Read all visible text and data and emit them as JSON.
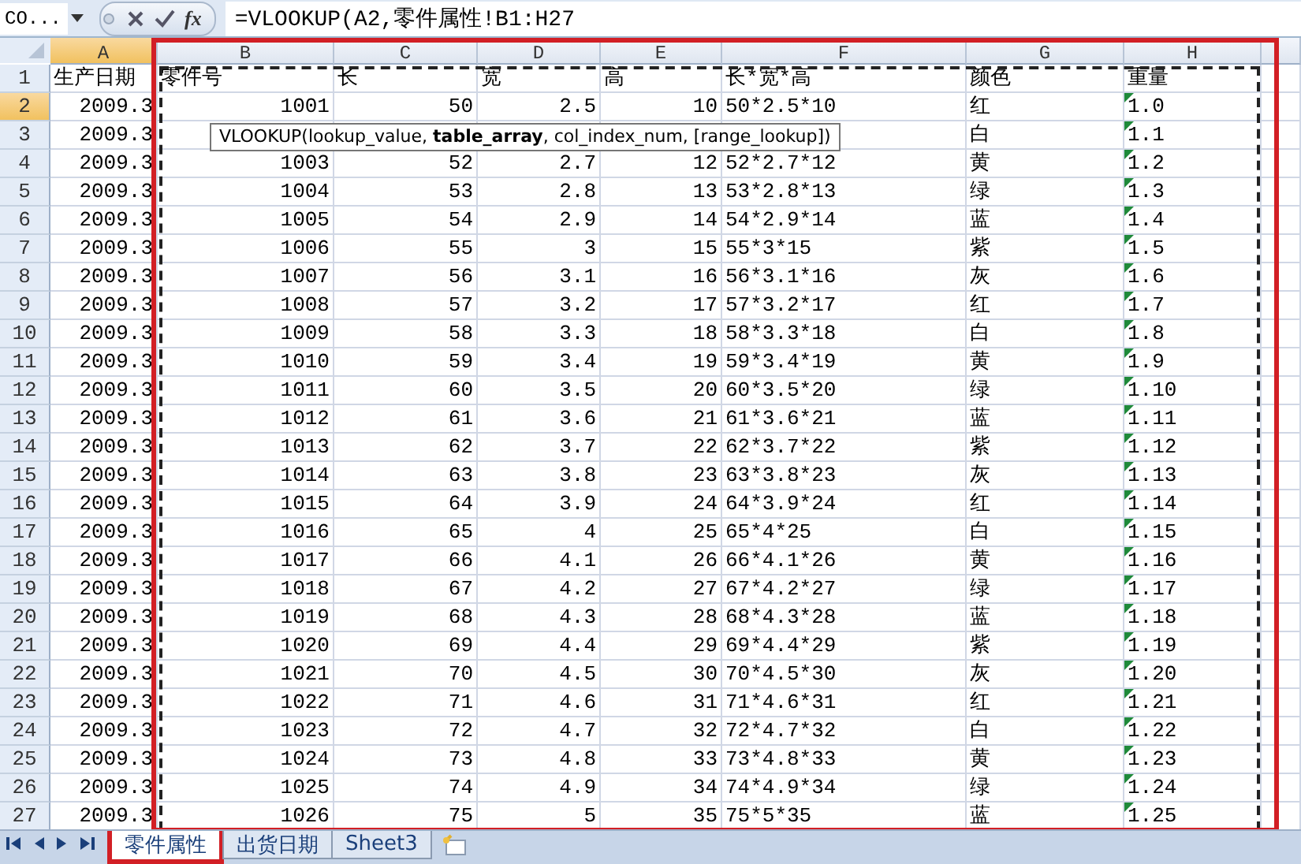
{
  "formula_bar": {
    "name_box": "CO...",
    "function_label": "fx",
    "formula": "=VLOOKUP(A2,零件属性!B1:H27"
  },
  "columns": [
    {
      "letter": "A",
      "kind": "number",
      "selected": true,
      "flagged": false
    },
    {
      "letter": "B",
      "kind": "number",
      "selected": false,
      "flagged": false
    },
    {
      "letter": "C",
      "kind": "number",
      "selected": false,
      "flagged": false
    },
    {
      "letter": "D",
      "kind": "number",
      "selected": false,
      "flagged": false
    },
    {
      "letter": "E",
      "kind": "number",
      "selected": false,
      "flagged": false
    },
    {
      "letter": "F",
      "kind": "text",
      "selected": false,
      "flagged": false
    },
    {
      "letter": "G",
      "kind": "text",
      "selected": false,
      "flagged": false
    },
    {
      "letter": "H",
      "kind": "text",
      "selected": false,
      "flagged": true
    }
  ],
  "rows": [
    {
      "number": "1",
      "kind": "header",
      "selected": false,
      "cells": [
        "生产日期",
        "零件号",
        "长",
        "宽",
        "高",
        "长*宽*高",
        "颜色",
        "重量"
      ]
    },
    {
      "number": "2",
      "kind": "data",
      "selected": true,
      "cells": [
        "2009.3",
        "1001",
        "50",
        "2.5",
        "10",
        "50*2.5*10",
        "红",
        "1.0"
      ]
    },
    {
      "number": "3",
      "kind": "data",
      "selected": false,
      "cells": [
        "2009.3",
        null,
        null,
        null,
        null,
        null,
        "白",
        "1.1"
      ]
    },
    {
      "number": "4",
      "kind": "data",
      "selected": false,
      "cells": [
        "2009.3",
        "1003",
        "52",
        "2.7",
        "12",
        "52*2.7*12",
        "黄",
        "1.2"
      ]
    },
    {
      "number": "5",
      "kind": "data",
      "selected": false,
      "cells": [
        "2009.3",
        "1004",
        "53",
        "2.8",
        "13",
        "53*2.8*13",
        "绿",
        "1.3"
      ]
    },
    {
      "number": "6",
      "kind": "data",
      "selected": false,
      "cells": [
        "2009.3",
        "1005",
        "54",
        "2.9",
        "14",
        "54*2.9*14",
        "蓝",
        "1.4"
      ]
    },
    {
      "number": "7",
      "kind": "data",
      "selected": false,
      "cells": [
        "2009.3",
        "1006",
        "55",
        "3",
        "15",
        "55*3*15",
        "紫",
        "1.5"
      ]
    },
    {
      "number": "8",
      "kind": "data",
      "selected": false,
      "cells": [
        "2009.3",
        "1007",
        "56",
        "3.1",
        "16",
        "56*3.1*16",
        "灰",
        "1.6"
      ]
    },
    {
      "number": "9",
      "kind": "data",
      "selected": false,
      "cells": [
        "2009.3",
        "1008",
        "57",
        "3.2",
        "17",
        "57*3.2*17",
        "红",
        "1.7"
      ]
    },
    {
      "number": "10",
      "kind": "data",
      "selected": false,
      "cells": [
        "2009.3",
        "1009",
        "58",
        "3.3",
        "18",
        "58*3.3*18",
        "白",
        "1.8"
      ]
    },
    {
      "number": "11",
      "kind": "data",
      "selected": false,
      "cells": [
        "2009.3",
        "1010",
        "59",
        "3.4",
        "19",
        "59*3.4*19",
        "黄",
        "1.9"
      ]
    },
    {
      "number": "12",
      "kind": "data",
      "selected": false,
      "cells": [
        "2009.3",
        "1011",
        "60",
        "3.5",
        "20",
        "60*3.5*20",
        "绿",
        "1.10"
      ]
    },
    {
      "number": "13",
      "kind": "data",
      "selected": false,
      "cells": [
        "2009.3",
        "1012",
        "61",
        "3.6",
        "21",
        "61*3.6*21",
        "蓝",
        "1.11"
      ]
    },
    {
      "number": "14",
      "kind": "data",
      "selected": false,
      "cells": [
        "2009.3",
        "1013",
        "62",
        "3.7",
        "22",
        "62*3.7*22",
        "紫",
        "1.12"
      ]
    },
    {
      "number": "15",
      "kind": "data",
      "selected": false,
      "cells": [
        "2009.3",
        "1014",
        "63",
        "3.8",
        "23",
        "63*3.8*23",
        "灰",
        "1.13"
      ]
    },
    {
      "number": "16",
      "kind": "data",
      "selected": false,
      "cells": [
        "2009.3",
        "1015",
        "64",
        "3.9",
        "24",
        "64*3.9*24",
        "红",
        "1.14"
      ]
    },
    {
      "number": "17",
      "kind": "data",
      "selected": false,
      "cells": [
        "2009.3",
        "1016",
        "65",
        "4",
        "25",
        "65*4*25",
        "白",
        "1.15"
      ]
    },
    {
      "number": "18",
      "kind": "data",
      "selected": false,
      "cells": [
        "2009.3",
        "1017",
        "66",
        "4.1",
        "26",
        "66*4.1*26",
        "黄",
        "1.16"
      ]
    },
    {
      "number": "19",
      "kind": "data",
      "selected": false,
      "cells": [
        "2009.3",
        "1018",
        "67",
        "4.2",
        "27",
        "67*4.2*27",
        "绿",
        "1.17"
      ]
    },
    {
      "number": "20",
      "kind": "data",
      "selected": false,
      "cells": [
        "2009.3",
        "1019",
        "68",
        "4.3",
        "28",
        "68*4.3*28",
        "蓝",
        "1.18"
      ]
    },
    {
      "number": "21",
      "kind": "data",
      "selected": false,
      "cells": [
        "2009.3",
        "1020",
        "69",
        "4.4",
        "29",
        "69*4.4*29",
        "紫",
        "1.19"
      ]
    },
    {
      "number": "22",
      "kind": "data",
      "selected": false,
      "cells": [
        "2009.3",
        "1021",
        "70",
        "4.5",
        "30",
        "70*4.5*30",
        "灰",
        "1.20"
      ]
    },
    {
      "number": "23",
      "kind": "data",
      "selected": false,
      "cells": [
        "2009.3",
        "1022",
        "71",
        "4.6",
        "31",
        "71*4.6*31",
        "红",
        "1.21"
      ]
    },
    {
      "number": "24",
      "kind": "data",
      "selected": false,
      "cells": [
        "2009.3",
        "1023",
        "72",
        "4.7",
        "32",
        "72*4.7*32",
        "白",
        "1.22"
      ]
    },
    {
      "number": "25",
      "kind": "data",
      "selected": false,
      "cells": [
        "2009.3",
        "1024",
        "73",
        "4.8",
        "33",
        "73*4.8*33",
        "黄",
        "1.23"
      ]
    },
    {
      "number": "26",
      "kind": "data",
      "selected": false,
      "cells": [
        "2009.3",
        "1025",
        "74",
        "4.9",
        "34",
        "74*4.9*34",
        "绿",
        "1.24"
      ]
    },
    {
      "number": "27",
      "kind": "data",
      "selected": false,
      "cells": [
        "2009.3",
        "1026",
        "75",
        "5",
        "35",
        "75*5*35",
        "蓝",
        "1.25"
      ]
    }
  ],
  "tooltip": "VLOOKUP(lookup_value, **table_array**, col_index_num, [range_lookup])",
  "sheet_tabs": [
    {
      "label": "零件属性",
      "selected": true
    },
    {
      "label": "出货日期",
      "selected": false
    },
    {
      "label": "Sheet3",
      "selected": false
    }
  ]
}
